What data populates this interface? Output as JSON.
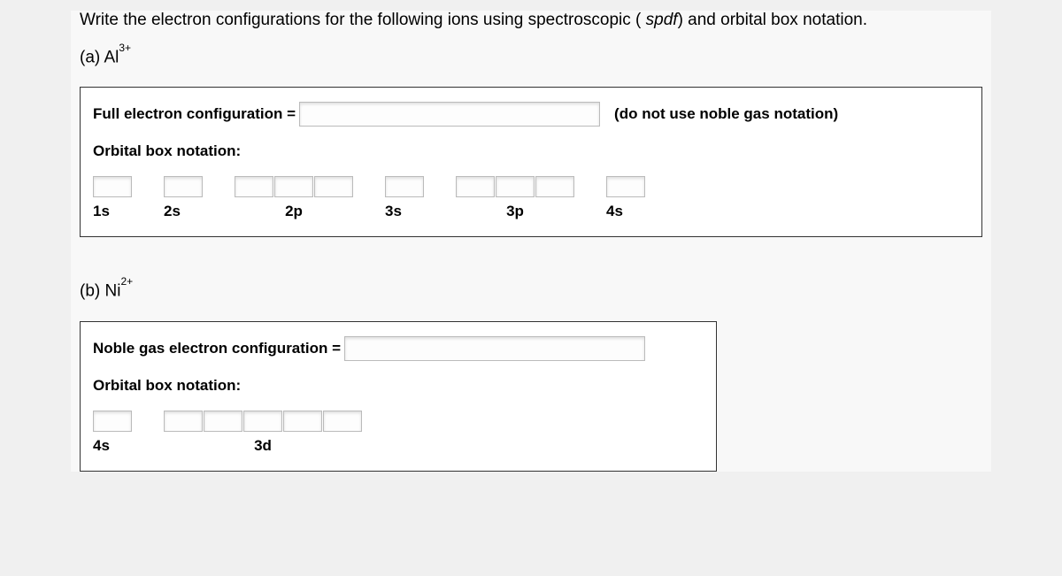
{
  "prompt": {
    "pre": "Write the electron configurations for the following ions using spectroscopic ( ",
    "italic": "spdf",
    "post": ") and orbital box notation."
  },
  "partA": {
    "label_pre": "(a)  Al",
    "label_sup": "3+",
    "config_label": "Full electron configuration =",
    "side_note": "(do not use noble gas notation)",
    "obn_label": "Orbital box notation:",
    "orbitals": {
      "s1": "1s",
      "s2": "2s",
      "p2": "2p",
      "s3": "3s",
      "p3": "3p",
      "s4": "4s"
    }
  },
  "partB": {
    "label_pre": "(b)   Ni",
    "label_sup": "2+",
    "config_label": "Noble gas electron configuration =",
    "obn_label": "Orbital box notation:",
    "orbitals": {
      "s4": "4s",
      "d3": "3d"
    }
  }
}
